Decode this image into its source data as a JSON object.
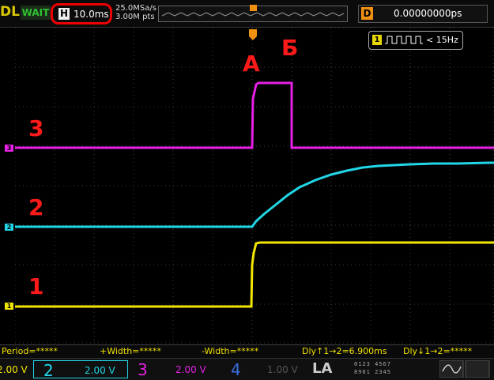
{
  "header": {
    "logo": "DL",
    "run_status": "WAIT",
    "horizontal_label": "H",
    "timebase": "10.0ms",
    "sample_rate": "25.0MSa/s",
    "memory_depth": "3.00M pts",
    "trigger_marker": "T",
    "delay_label": "D",
    "delay_value": "0.00000000ps"
  },
  "display": {
    "counter_channel": "1",
    "counter_value": "< 15Hz",
    "label_a": "А",
    "label_b": "Б",
    "trace_label_1": "1",
    "trace_label_2": "2",
    "trace_label_3": "3",
    "trigger_pos_marker": "T",
    "ch1_marker": "1",
    "ch2_marker": "2",
    "ch3_marker": "3",
    "colors": {
      "ch1": "#f2e600",
      "ch2": "#21d6e6",
      "ch3": "#e620e6",
      "ch4": "#3a6fe0",
      "grid": "#3c3c3c"
    }
  },
  "measurements": {
    "period": "Period=*****",
    "pos_width": "+Width=*****",
    "neg_width": "-Width=*****",
    "delay_rise": "Dly↑1→2=6.900ms",
    "delay_fall": "Dly↓1→2=*****"
  },
  "channels": [
    {
      "num": "1",
      "scale": "2.00 V"
    },
    {
      "num": "2",
      "scale": "2.00 V"
    },
    {
      "num": "3",
      "scale": "2.00 V"
    },
    {
      "num": "4",
      "scale": "1.00 V"
    }
  ],
  "footer": {
    "la_label": "LA",
    "la_digits_top": "0123 4567",
    "la_digits_bot": "8901 2345"
  }
}
